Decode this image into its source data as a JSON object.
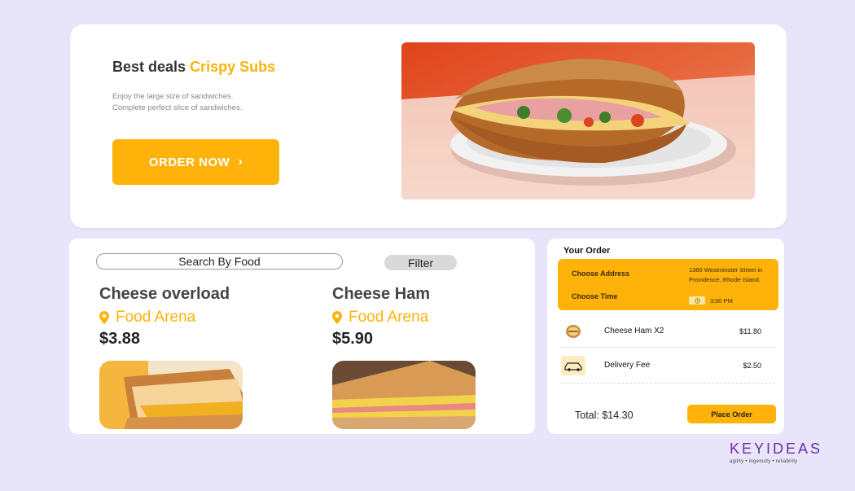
{
  "hero": {
    "title_prefix": "Best deals",
    "title_accent": "Crispy Subs",
    "desc_line1": "Enjoy the large size of sandwiches.",
    "desc_line2": "Complete perfect slice of sandwiches.",
    "order_now_label": "ORDER NOW"
  },
  "menu": {
    "search_label": "Search By Food",
    "filter_label": "Filter",
    "items": [
      {
        "name": "Cheese overload",
        "location": "Food Arena",
        "price": "$3.88"
      },
      {
        "name": "Cheese Ham",
        "location": "Food Arena",
        "price": "$5.90"
      }
    ]
  },
  "order": {
    "title": "Your Order",
    "choose_address": "Choose Address",
    "choose_time": "Choose Time",
    "address": "1380 Westminster Street in Providence, Rhode Island.",
    "time": "3:00 PM",
    "lines": [
      {
        "name": "Cheese Ham  X2",
        "price": "$11.80",
        "icon": "sandwich-icon"
      },
      {
        "name": "Delivery Fee",
        "price": "$2.50",
        "icon": "car-icon"
      }
    ],
    "total": "Total: $14.30",
    "place_order_label": "Place Order"
  },
  "brand": {
    "name": "KEYIDEAS",
    "tagline": "agility • ingenuity • reliability"
  },
  "colors": {
    "accent": "#ffb20a",
    "background": "#e8e4fa",
    "brand": "#6a2fa8"
  }
}
